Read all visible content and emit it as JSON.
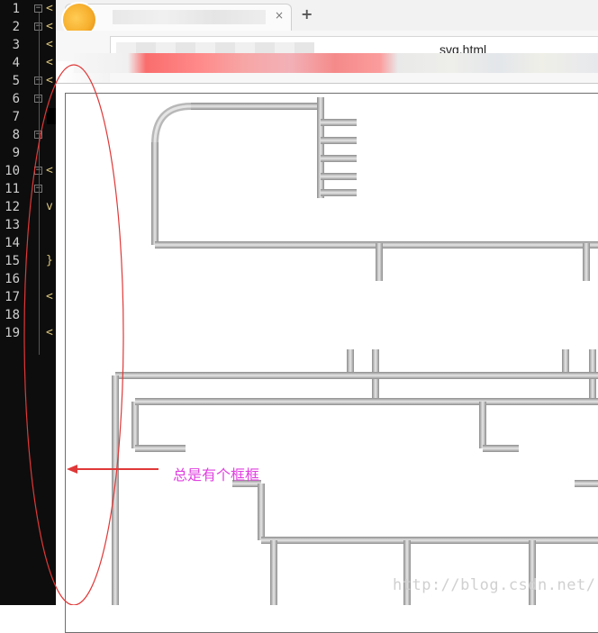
{
  "editor": {
    "line_numbers": [
      "1",
      "2",
      "3",
      "4",
      "5",
      "6",
      "7",
      "8",
      "9",
      "10",
      "11",
      "12",
      "13",
      "14",
      "15",
      "16",
      "17",
      "18",
      "19"
    ],
    "code_glyphs": {
      "1": "<",
      "2": "<",
      "3": "<",
      "4": "<",
      "5": "<",
      "10": "<",
      "12": "v",
      "15": "}",
      "17": "<",
      "19": "<"
    },
    "fold_marker": "−"
  },
  "browser": {
    "tab_close": "×",
    "new_tab": "+",
    "url_visible": "svg.html",
    "annotation": "总是有个框框",
    "watermark": "http://blog.csdn.net/"
  },
  "colors": {
    "annotation_color": "#e040e0",
    "arrow_color": "#e03838",
    "ellipse_color": "#e03838",
    "pipe_color": "#a8a8a8"
  }
}
